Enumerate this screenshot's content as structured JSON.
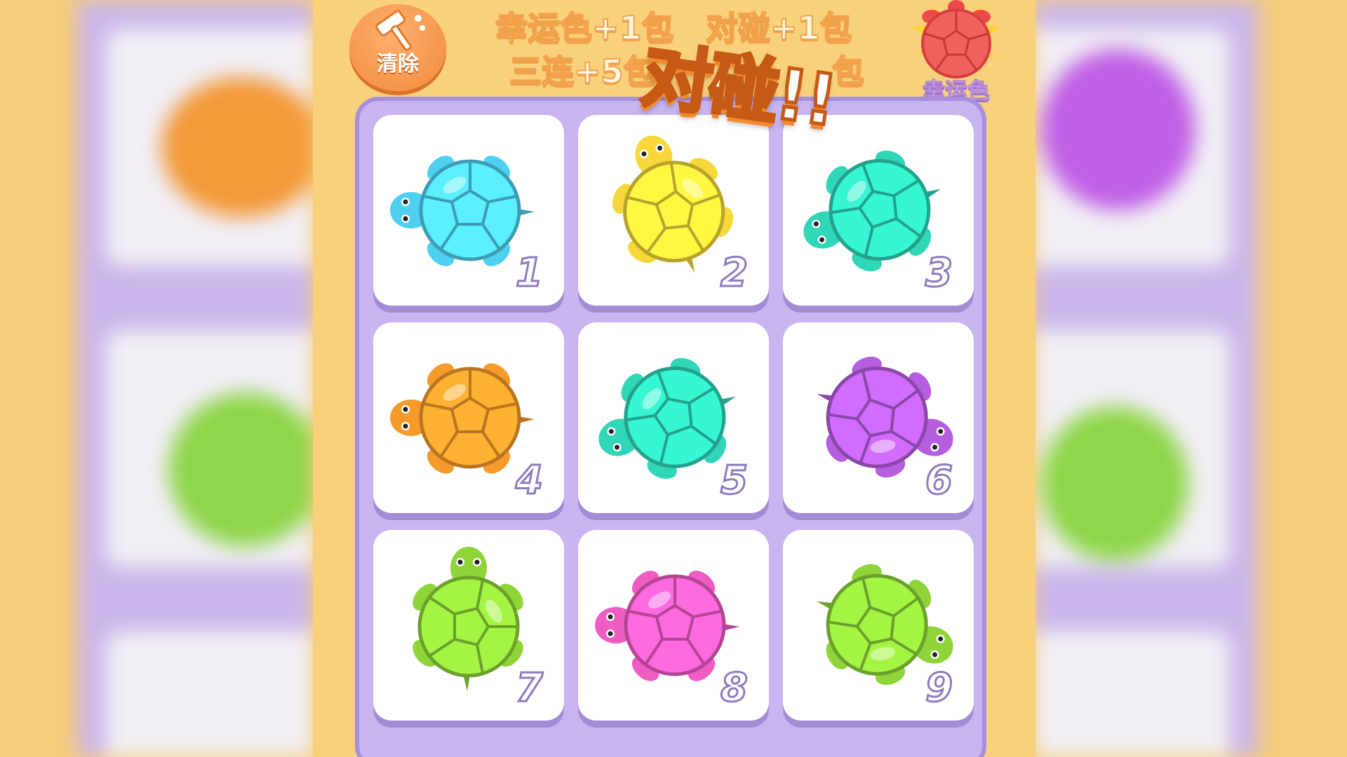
{
  "header": {
    "clear_button": {
      "label": "清除",
      "icon": "hammer-icon"
    },
    "rules": [
      "幸运色+1包",
      "对碰+1包",
      "三连+5包",
      "包"
    ],
    "lucky_color": {
      "label": "幸运色",
      "color": "#ef5a55"
    },
    "combo_banner": "对碰!!"
  },
  "tiles": [
    {
      "number": "1",
      "color": "#4fd0f0",
      "icon": "turtle-icon"
    },
    {
      "number": "2",
      "color": "#f7d83a",
      "icon": "turtle-icon"
    },
    {
      "number": "3",
      "color": "#2fd6b8",
      "icon": "turtle-icon"
    },
    {
      "number": "4",
      "color": "#f59a2b",
      "icon": "turtle-icon"
    },
    {
      "number": "5",
      "color": "#2fd6b8",
      "icon": "turtle-icon"
    },
    {
      "number": "6",
      "color": "#b75ee0",
      "icon": "turtle-icon"
    },
    {
      "number": "7",
      "color": "#8fd53a",
      "icon": "turtle-icon"
    },
    {
      "number": "8",
      "color": "#ee5cc4",
      "icon": "turtle-icon"
    },
    {
      "number": "9",
      "color": "#8fd53a",
      "icon": "turtle-icon"
    }
  ]
}
